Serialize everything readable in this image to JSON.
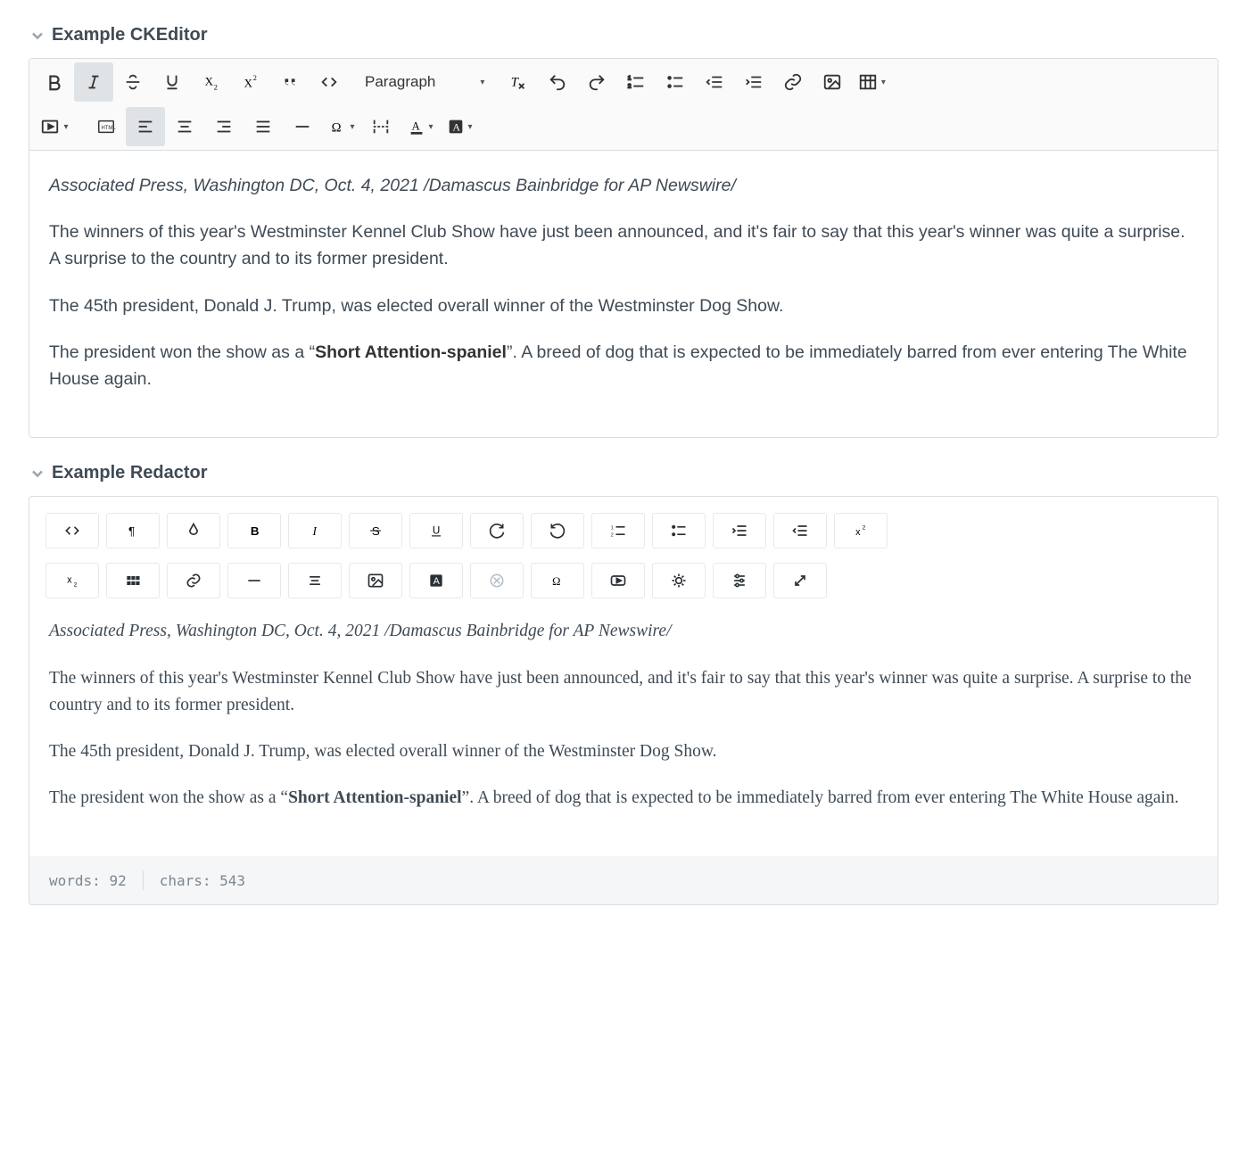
{
  "fields": {
    "ckeditor": {
      "label": "Example CKEditor"
    },
    "redactor": {
      "label": "Example Redactor"
    }
  },
  "ckeditor": {
    "heading_selected": "Paragraph",
    "content": {
      "byline": "Associated Press, Washington DC, Oct. 4, 2021 /Damascus Bainbridge for AP Newswire/",
      "p1": "The winners of this year's Westminster Kennel Club Show have just been announced, and it's fair to say that this year's winner was quite a surprise. A surprise to the country and to its former president.",
      "p2": "The 45th president, Donald J. Trump, was elected overall winner of the Westminster Dog Show.",
      "p3_before": "The president won the show as a “",
      "p3_bold": "Short Attention-spaniel",
      "p3_after": "”. A breed of dog that is expected to be immediately barred from ever entering The White House again."
    }
  },
  "redactor": {
    "content": {
      "byline": "Associated Press, Washington DC, Oct. 4, 2021 /Damascus Bainbridge for AP Newswire/",
      "p1": "The winners of this year's Westminster Kennel Club Show have just been announced, and it's fair to say that this year's winner was quite a surprise. A surprise to the country and to its former president.",
      "p2": "The 45th president, Donald J. Trump, was elected overall winner of the Westminster Dog Show.",
      "p3_before": "The president won the show as a “",
      "p3_bold": "Short Attention-spaniel",
      "p3_after": "”. A breed of dog that is expected to be immediately barred from ever entering The White House again."
    },
    "status": {
      "words_label": "words:",
      "words_value": "92",
      "chars_label": "chars:",
      "chars_value": "543"
    }
  }
}
